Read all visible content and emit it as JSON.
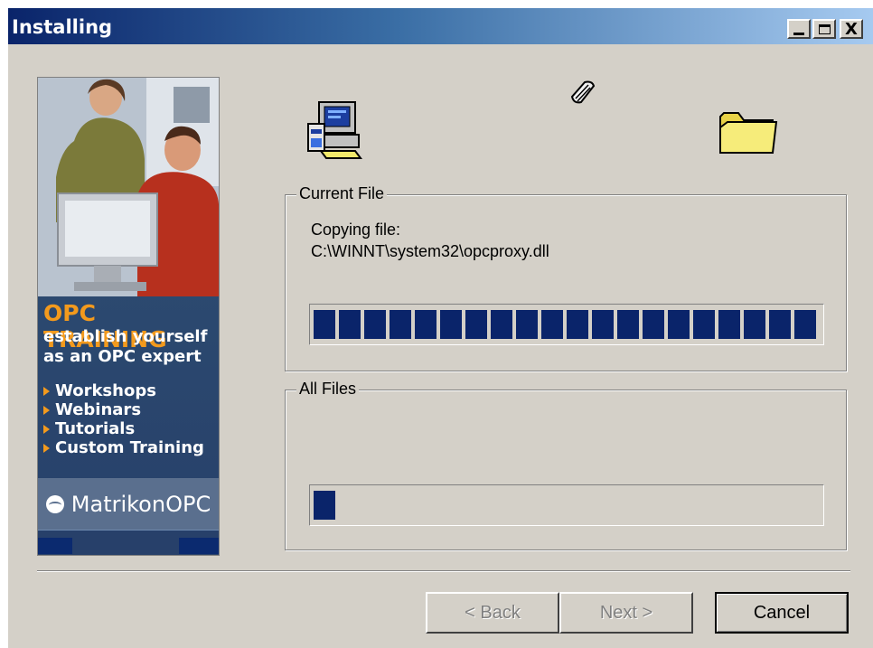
{
  "window": {
    "title": "Installing",
    "controls": {
      "minimize": "_",
      "maximize": "□",
      "close": "X"
    }
  },
  "banner": {
    "headline": "OPC TRAINING",
    "subline1": "establish yourself",
    "subline2": "as an OPC expert",
    "items": [
      "Workshops",
      "Webinars",
      "Tutorials",
      "Custom Training"
    ],
    "logo": "MatrikonOPC",
    "accent_color": "#f39a1d",
    "background_color": "#2c4a70"
  },
  "icons": [
    "computer-icon",
    "paper-icon",
    "folder-icon"
  ],
  "current_file": {
    "legend": "Current File",
    "label": "Copying file:",
    "path": "C:\\WINNT\\system32\\opcproxy.dll",
    "progress": 1.0
  },
  "all_files": {
    "legend": "All Files",
    "progress": 0.04
  },
  "buttons": {
    "back": "< Back",
    "next": "Next >",
    "cancel": "Cancel"
  },
  "colors": {
    "dialog_bg": "#d4d0c8",
    "progress_fill": "#0a246a",
    "title_gradient_start": "#0a246a",
    "title_gradient_end": "#a6caf0"
  }
}
